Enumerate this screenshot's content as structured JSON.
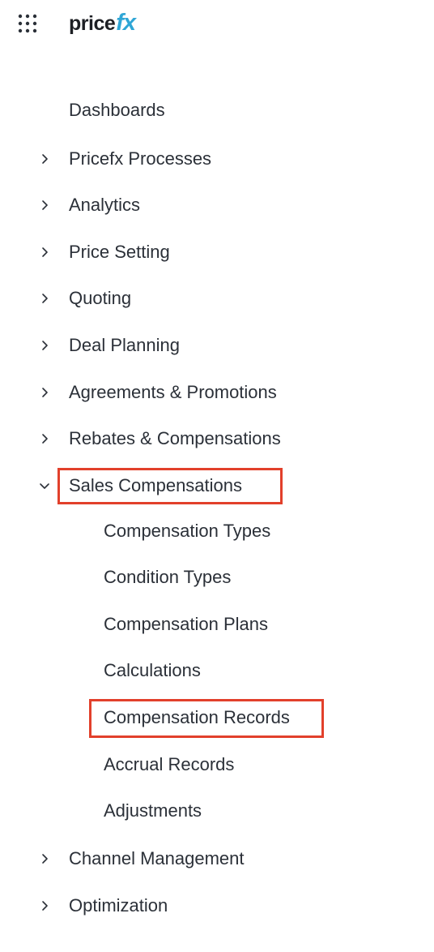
{
  "brand": {
    "name_part1": "price",
    "name_part2": "fx"
  },
  "nav": {
    "dashboards": "Dashboards",
    "pricefx_processes": "Pricefx Processes",
    "analytics": "Analytics",
    "price_setting": "Price Setting",
    "quoting": "Quoting",
    "deal_planning": "Deal Planning",
    "agreements_promotions": "Agreements & Promotions",
    "rebates_compensations": "Rebates & Compensations",
    "sales_compensations": {
      "label": "Sales Compensations",
      "expanded": true,
      "children": {
        "compensation_types": "Compensation Types",
        "condition_types": "Condition Types",
        "compensation_plans": "Compensation Plans",
        "calculations": "Calculations",
        "compensation_records": "Compensation Records",
        "accrual_records": "Accrual Records",
        "adjustments": "Adjustments"
      }
    },
    "channel_management": "Channel Management",
    "optimization": "Optimization"
  },
  "icons": {
    "app_switcher": "apps-grid-icon",
    "collapsed": "chevron-right-icon",
    "expanded": "chevron-down-icon"
  },
  "colors": {
    "highlight": "#e2402b",
    "logo_accent": "#2fa6d6",
    "text": "#2b3038"
  }
}
